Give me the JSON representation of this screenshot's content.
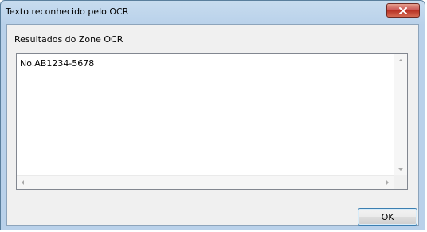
{
  "window": {
    "title": "Texto reconhecido pelo OCR"
  },
  "dialog": {
    "group_label": "Resultados do Zone OCR",
    "result_text": "No.AB1234-5678",
    "ok_label": "OK"
  },
  "icons": {
    "close": "close-icon",
    "scroll_up": "scroll-up-arrow-icon",
    "scroll_down": "scroll-down-arrow-icon",
    "scroll_left": "scroll-left-arrow-icon",
    "scroll_right": "scroll-right-arrow-icon"
  },
  "colors": {
    "titlebar": "#b9d1ea",
    "close_button": "#c75050",
    "client_background": "#f0f0f0",
    "default_button_border": "#3c7fb1"
  }
}
